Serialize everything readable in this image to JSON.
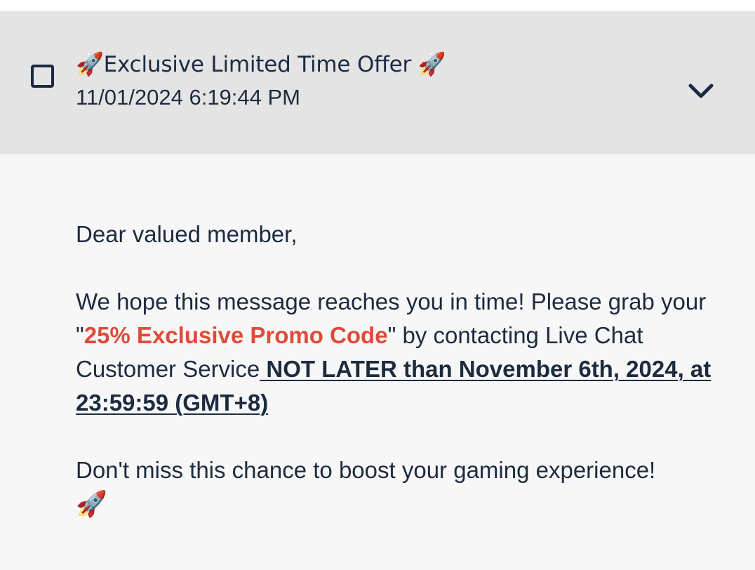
{
  "header": {
    "title_prefix_icon": "🚀",
    "title": "Exclusive Limited Time Offer",
    "title_suffix_icon": "🚀",
    "datetime": "11/01/2024 6:19:44 PM",
    "checkbox_icon": "checkbox-empty-icon",
    "expand_icon": "chevron-down-icon"
  },
  "message": {
    "greeting": "Dear valued member,",
    "p2_part1": "We hope this message reaches you in time! Please grab your \"",
    "promo_text": "25% Exclusive Promo Code",
    "p2_part2": "\" by contacting Live Chat Customer Service",
    "deadline": " NOT LATER than November 6th, 2024, at 23:59:59 (GMT+8)",
    "closing": "Don't miss this chance to boost your gaming experience!",
    "closing_icon": "🚀"
  },
  "colors": {
    "header_bg": "#e4e4e4",
    "body_bg": "#f7f7f7",
    "text": "#1d2b3f",
    "promo": "#e04a3a"
  }
}
